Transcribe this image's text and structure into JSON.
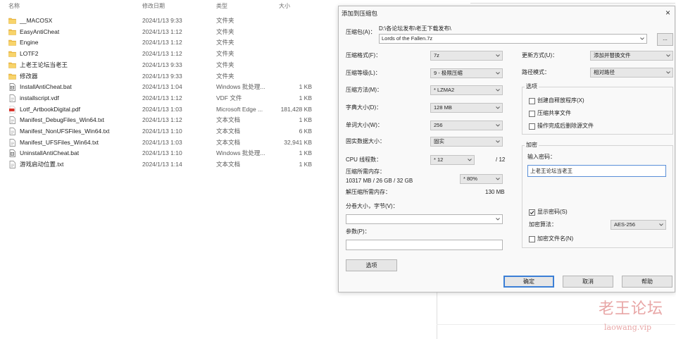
{
  "explorer": {
    "columns": {
      "name": "名称",
      "modified": "修改日期",
      "type": "类型",
      "size": "大小"
    },
    "files": [
      {
        "icon": "folder-icon",
        "name": "__MACOSX",
        "modified": "2024/1/13 9:33",
        "type": "文件夹"
      },
      {
        "icon": "folder-icon",
        "name": "EasyAntiCheat",
        "modified": "2024/1/13 1:12",
        "type": "文件夹"
      },
      {
        "icon": "folder-icon",
        "name": "Engine",
        "modified": "2024/1/13 1:12",
        "type": "文件夹"
      },
      {
        "icon": "folder-icon",
        "name": "LOTF2",
        "modified": "2024/1/13 1:12",
        "type": "文件夹"
      },
      {
        "icon": "folder-icon",
        "name": "上老王论坛当老王",
        "modified": "2024/1/13 9:33",
        "type": "文件夹"
      },
      {
        "icon": "folder-icon",
        "name": "修改器",
        "modified": "2024/1/13 9:33",
        "type": "文件夹"
      },
      {
        "icon": "batch-file-icon",
        "name": "InstallAntiCheat.bat",
        "modified": "2024/1/13 1:04",
        "type": "Windows 批处理...",
        "size": "1 KB"
      },
      {
        "icon": "document-icon",
        "name": "installscript.vdf",
        "modified": "2024/1/13 1:12",
        "type": "VDF 文件",
        "size": "1 KB"
      },
      {
        "icon": "pdf-icon",
        "name": "Lotf_ArtbookDigital.pdf",
        "modified": "2024/1/13 1:03",
        "type": "Microsoft Edge ...",
        "size": "181,428 KB"
      },
      {
        "icon": "document-icon",
        "name": "Manifest_DebugFiles_Win64.txt",
        "modified": "2024/1/13 1:12",
        "type": "文本文档",
        "size": "1 KB"
      },
      {
        "icon": "document-icon",
        "name": "Manifest_NonUFSFiles_Win64.txt",
        "modified": "2024/1/13 1:10",
        "type": "文本文档",
        "size": "6 KB"
      },
      {
        "icon": "document-icon",
        "name": "Manifest_UFSFiles_Win64.txt",
        "modified": "2024/1/13 1:03",
        "type": "文本文档",
        "size": "32,941 KB"
      },
      {
        "icon": "batch-file-icon",
        "name": "UninstallAntiCheat.bat",
        "modified": "2024/1/13 1:10",
        "type": "Windows 批处理...",
        "size": "1 KB"
      },
      {
        "icon": "document-icon",
        "name": "游戏启动位置.txt",
        "modified": "2024/1/13 1:14",
        "type": "文本文档",
        "size": "1 KB"
      }
    ]
  },
  "dialog": {
    "title": "添加到压缩包",
    "close": "×",
    "archive": {
      "label": "压缩包(A)：",
      "folder": "D:\\各论坛发布\\老王下载发布\\",
      "value": "Lords of the Fallen.7z",
      "browse": "..."
    },
    "format": {
      "label": "压缩格式(F)：",
      "value": "7z"
    },
    "level": {
      "label": "压缩等级(L)：",
      "value": "9 - 极限压缩"
    },
    "method": {
      "label": "压缩方法(M)：",
      "value": "* LZMA2"
    },
    "dictionary": {
      "label": "字典大小(D)：",
      "value": "128 MB"
    },
    "word_size": {
      "label": "单词大小(W)：",
      "value": "256"
    },
    "solid_block": {
      "label": "固实数据大小：",
      "value": "固实"
    },
    "threads": {
      "label": "CPU 线程数：",
      "value": "* 12",
      "max": "/ 12"
    },
    "memory_compress": {
      "label": "压缩所需内存：",
      "detail": "10317 MB / 26 GB / 32 GB",
      "value": "* 80%"
    },
    "memory_decompress": {
      "label": "解压缩所需内存：",
      "value": "130 MB"
    },
    "volume": {
      "label": "分卷大小，字节(V)："
    },
    "parameters": {
      "label": "参数(P)："
    },
    "options_button": "选项",
    "update_mode": {
      "label": "更新方式(U)：",
      "value": "添加并替换文件"
    },
    "path_mode": {
      "label": "路径模式：",
      "value": "相对路径"
    },
    "options_group": {
      "title": "选项",
      "items": [
        {
          "label": "创建自释放程序(X)",
          "checked": false
        },
        {
          "label": "压缩共享文件",
          "checked": false
        },
        {
          "label": "操作完成后删除源文件",
          "checked": false
        }
      ]
    },
    "encryption": {
      "title": "加密",
      "password_label": "输入密码：",
      "password": "上老王论坛当老王",
      "show_password": {
        "label": "显示密码(S)",
        "checked": true
      },
      "method_label": "加密算法：",
      "method": "AES-256",
      "encrypt_names": {
        "label": "加密文件名(N)",
        "checked": false
      }
    },
    "buttons": {
      "ok": "确定",
      "cancel": "取消",
      "help": "帮助"
    }
  },
  "watermark": {
    "brand": "老王论坛",
    "site": "laowang.vip"
  }
}
